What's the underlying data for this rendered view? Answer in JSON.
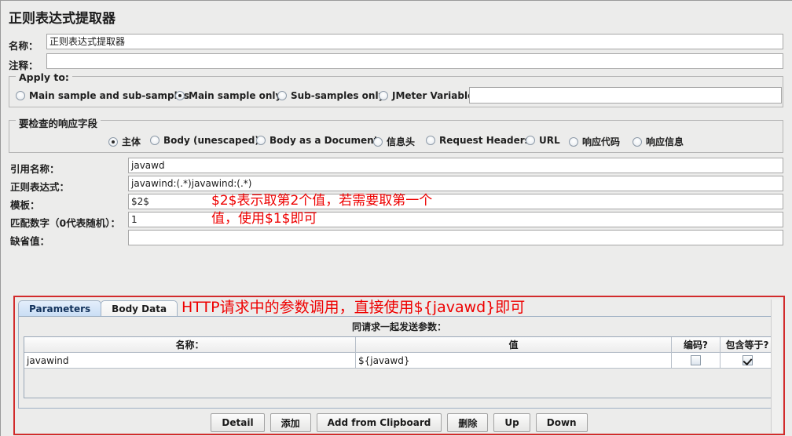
{
  "window": {
    "title": "正则表达式提取器"
  },
  "form": {
    "name_label": "名称：",
    "name_value": "正则表达式提取器",
    "comment_label": "注释：",
    "comment_value": ""
  },
  "apply_to": {
    "group_title": "Apply to:",
    "options": [
      {
        "label": "Main sample and sub-samples",
        "selected": false
      },
      {
        "label": "Main sample only",
        "selected": true
      },
      {
        "label": "Sub-samples only",
        "selected": false
      },
      {
        "label": "JMeter Variable",
        "selected": false
      }
    ],
    "variable_value": ""
  },
  "response_field": {
    "group_title": "要检查的响应字段",
    "options": [
      {
        "label": "主体",
        "selected": true
      },
      {
        "label": "Body (unescaped)",
        "selected": false
      },
      {
        "label": "Body as a Document",
        "selected": false
      },
      {
        "label": "信息头",
        "selected": false
      },
      {
        "label": "Request Headers",
        "selected": false
      },
      {
        "label": "URL",
        "selected": false
      },
      {
        "label": "响应代码",
        "selected": false
      },
      {
        "label": "响应信息",
        "selected": false
      }
    ]
  },
  "extractor": {
    "ref_name_label": "引用名称：",
    "ref_name_value": "javawd",
    "regex_label": "正则表达式：",
    "regex_value": "javawind:(.*)javawind:(.*)",
    "template_label": "模板：",
    "template_value": "$2$",
    "match_no_label": "匹配数字（0代表随机）：",
    "match_no_value": "1",
    "default_label": "缺省值：",
    "default_value": ""
  },
  "annotations": {
    "template_note": "$2$表示取第2个值，若需要取第一个\n值，使用$1$即可",
    "params_note": "HTTP请求中的参数调用，直接使用${javawd}即可",
    "color": "#ee0000"
  },
  "params_panel": {
    "tabs": [
      {
        "label": "Parameters",
        "active": true
      },
      {
        "label": "Body Data",
        "active": false
      }
    ],
    "send_with_request_label": "同请求一起发送参数：",
    "table": {
      "headers": [
        "名称：",
        "值",
        "编码?",
        "包含等于?"
      ],
      "rows": [
        {
          "name": "javawind",
          "value": "${javawd}",
          "encode": false,
          "include_equals": true
        }
      ]
    },
    "buttons": [
      "Detail",
      "添加",
      "Add from Clipboard",
      "删除",
      "Up",
      "Down"
    ]
  }
}
